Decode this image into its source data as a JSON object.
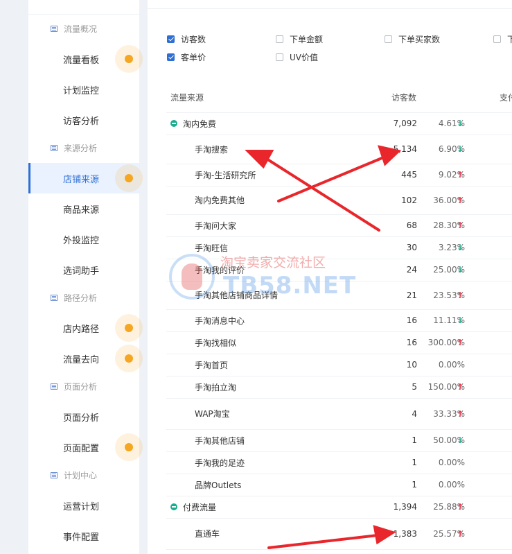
{
  "sidebar": {
    "groups": [
      {
        "label": "流量概况",
        "icon": "report-icon"
      },
      {
        "label": "来源分析",
        "icon": "report-icon"
      },
      {
        "label": "路径分析",
        "icon": "report-icon"
      },
      {
        "label": "页面分析",
        "icon": "report-icon"
      },
      {
        "label": "计划中心",
        "icon": "report-icon"
      }
    ],
    "items": [
      {
        "label": "流量看板",
        "badge": true
      },
      {
        "label": "计划监控"
      },
      {
        "label": "访客分析"
      },
      {
        "label": "店铺来源",
        "active": true,
        "badge": true
      },
      {
        "label": "商品来源"
      },
      {
        "label": "外投监控"
      },
      {
        "label": "选词助手"
      },
      {
        "label": "店内路径",
        "badge": true
      },
      {
        "label": "流量去向",
        "badge": true
      },
      {
        "label": "页面分析"
      },
      {
        "label": "页面配置",
        "badge": true
      },
      {
        "label": "运营计划"
      },
      {
        "label": "事件配置"
      }
    ]
  },
  "filters": [
    {
      "label": "访客数",
      "checked": true
    },
    {
      "label": "下单金额",
      "checked": false
    },
    {
      "label": "下单买家数",
      "checked": false
    },
    {
      "label": "下",
      "checked": false
    },
    {
      "label": "客单价",
      "checked": true
    },
    {
      "label": "UV价值",
      "checked": false
    }
  ],
  "table": {
    "headers": {
      "source": "流量来源",
      "visitors": "访客数",
      "extra": "支付"
    },
    "rows": [
      {
        "name": "淘内免费",
        "value": "7,092",
        "pct": "4.61%",
        "trend": "down",
        "group": true
      },
      {
        "name": "手淘搜索",
        "value": "5,134",
        "pct": "6.90%",
        "trend": "down"
      },
      {
        "name": "手淘-生活研究所",
        "value": "445",
        "pct": "9.02%",
        "trend": "up"
      },
      {
        "name": "淘内免费其他",
        "value": "102",
        "pct": "36.00%",
        "trend": "up"
      },
      {
        "name": "手淘问大家",
        "value": "68",
        "pct": "28.30%",
        "trend": "up"
      },
      {
        "name": "手淘旺信",
        "value": "30",
        "pct": "3.23%",
        "trend": "down"
      },
      {
        "name": "手淘我的评价",
        "value": "24",
        "pct": "25.00%",
        "trend": "down"
      },
      {
        "name": "手淘其他店铺商品详情",
        "value": "21",
        "pct": "23.53%",
        "trend": "up"
      },
      {
        "name": "手淘消息中心",
        "value": "16",
        "pct": "11.11%",
        "trend": "down"
      },
      {
        "name": "手淘找相似",
        "value": "16",
        "pct": "300.00%",
        "trend": "up"
      },
      {
        "name": "手淘首页",
        "value": "10",
        "pct": "0.00%",
        "trend": ""
      },
      {
        "name": "手淘拍立淘",
        "value": "5",
        "pct": "150.00%",
        "trend": "up"
      },
      {
        "name": "WAP淘宝",
        "value": "4",
        "pct": "33.33%",
        "trend": "up"
      },
      {
        "name": "手淘其他店铺",
        "value": "1",
        "pct": "50.00%",
        "trend": "down"
      },
      {
        "name": "手淘我的足迹",
        "value": "1",
        "pct": "0.00%",
        "trend": ""
      },
      {
        "name": "品牌Outlets",
        "value": "1",
        "pct": "0.00%",
        "trend": ""
      },
      {
        "name": "付费流量",
        "value": "1,394",
        "pct": "25.88%",
        "trend": "up",
        "group": true
      },
      {
        "name": "直通车",
        "value": "1,383",
        "pct": "25.57%",
        "trend": "up"
      }
    ]
  },
  "watermark": {
    "text": "淘宝卖家交流社区",
    "net": "TB58.NET"
  },
  "colors": {
    "accent": "#2e6fd6",
    "up": "#e8334a",
    "down": "#1aad8f",
    "badge": "#f5a623"
  }
}
